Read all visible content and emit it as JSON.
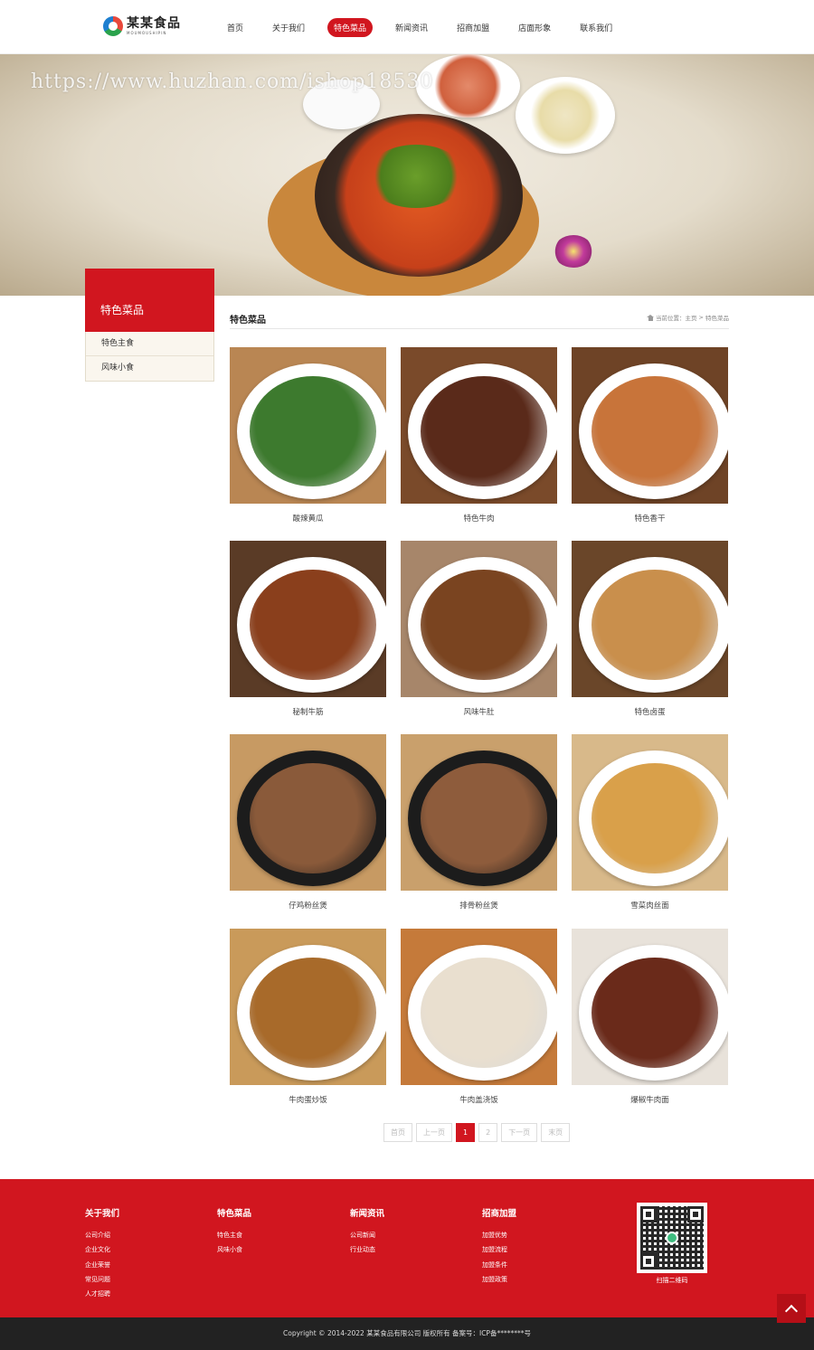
{
  "header": {
    "logo_cn": "某某食品",
    "logo_en": "MOUMOUSHIPIN",
    "nav": [
      {
        "label": "首页",
        "active": false
      },
      {
        "label": "关于我们",
        "active": false
      },
      {
        "label": "特色菜品",
        "active": true
      },
      {
        "label": "新闻资讯",
        "active": false
      },
      {
        "label": "招商加盟",
        "active": false
      },
      {
        "label": "店面形象",
        "active": false
      },
      {
        "label": "联系我们",
        "active": false
      }
    ]
  },
  "banner": {
    "watermark": "https://www.huzhan.com/ishop18530"
  },
  "sidebar": {
    "title": "特色菜品",
    "items": [
      "特色主食",
      "风味小食"
    ]
  },
  "content": {
    "title": "特色菜品",
    "breadcrumb": {
      "prefix": "当前位置：",
      "home": "主页",
      "sep": ">",
      "current": "特色菜品"
    }
  },
  "products": [
    {
      "name": "酸辣黄瓜",
      "plate": "#ffffff",
      "food": "#3d7a2e",
      "bg": "#b98653"
    },
    {
      "name": "特色牛肉",
      "plate": "#ffffff",
      "food": "#5a2a1a",
      "bg": "#7a4a2a"
    },
    {
      "name": "特色香干",
      "plate": "#ffffff",
      "food": "#c8743a",
      "bg": "#6e4326"
    },
    {
      "name": "秘制牛筋",
      "plate": "#ffffff",
      "food": "#8a3f1c",
      "bg": "#5a3b26"
    },
    {
      "name": "风味牛肚",
      "plate": "#ffffff",
      "food": "#7a4420",
      "bg": "#a7866a"
    },
    {
      "name": "特色卤蛋",
      "plate": "#ffffff",
      "food": "#c98f4c",
      "bg": "#6a4629"
    },
    {
      "name": "仔鸡粉丝煲",
      "plate": "#1c1c1c",
      "food": "#8a5a3a",
      "bg": "#c79a63"
    },
    {
      "name": "排骨粉丝煲",
      "plate": "#1c1c1c",
      "food": "#8e5c3c",
      "bg": "#c9a06c"
    },
    {
      "name": "雪菜肉丝面",
      "plate": "#ffffff",
      "food": "#d9a04a",
      "bg": "#d8b98a"
    },
    {
      "name": "牛肉蛋炒饭",
      "plate": "#ffffff",
      "food": "#a86a2a",
      "bg": "#c99a5a"
    },
    {
      "name": "牛肉盖浇饭",
      "plate": "#ffffff",
      "food": "#e9dfcf",
      "bg": "#c57a3a"
    },
    {
      "name": "爆椒牛肉面",
      "plate": "#ffffff",
      "food": "#6a2a1a",
      "bg": "#e8e2da"
    }
  ],
  "pagination": {
    "first": "首页",
    "prev": "上一页",
    "pages": [
      "1",
      "2"
    ],
    "current": "1",
    "next": "下一页",
    "last": "末页"
  },
  "footer": {
    "columns": [
      {
        "title": "关于我们",
        "links": [
          "公司介绍",
          "企业文化",
          "企业荣誉",
          "常见问题",
          "人才招聘"
        ]
      },
      {
        "title": "特色菜品",
        "links": [
          "特色主食",
          "风味小食"
        ]
      },
      {
        "title": "新闻资讯",
        "links": [
          "公司新闻",
          "行业动态"
        ]
      },
      {
        "title": "招商加盟",
        "links": [
          "加盟优势",
          "加盟流程",
          "加盟条件",
          "加盟政策"
        ]
      }
    ],
    "qr_caption": "扫描二维码",
    "copyright": "Copyright © 2014-2022 某某食品有限公司 版权所有   备案号：ICP备********号"
  },
  "colors": {
    "brand_red": "#d1161f",
    "copyright_bg": "#222222"
  }
}
